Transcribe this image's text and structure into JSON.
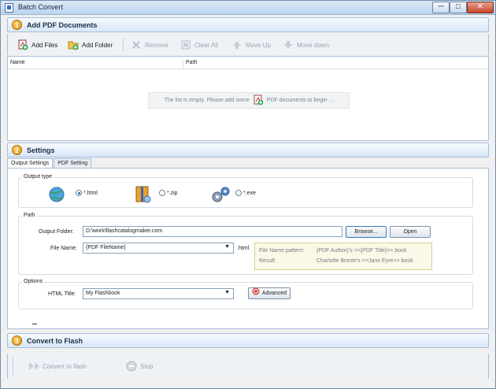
{
  "window": {
    "title": "Batch Convert",
    "controls": [
      "─",
      "□",
      "✕"
    ]
  },
  "sections": {
    "add": {
      "num": "1",
      "label": "Add PDF Documents"
    },
    "settings": {
      "num": "2",
      "label": "Settings"
    },
    "convert": {
      "num": "3",
      "label": "Convert to Flash"
    }
  },
  "toolbar": {
    "add_files": "Add Files",
    "add_folder": "Add Folder",
    "remove": "Remove",
    "clear_all": "Clear All",
    "move_up": "Move Up",
    "move_down": "Move down"
  },
  "list": {
    "columns": [
      "Name",
      "Path"
    ],
    "empty_text_1": "The list is empty. Please add some",
    "empty_text_2": "PDF documents to begin ..."
  },
  "tabs": [
    "Output Settings",
    "PDF Setting"
  ],
  "output_type": {
    "title": "Output type",
    "options": [
      "*.html",
      "*.zip",
      "*.exe"
    ],
    "selected": "*.html"
  },
  "path": {
    "title": "Path",
    "output_folder_label": "Output Folder:",
    "output_folder_value": "D:\\work\\flashcatalogmaker.com",
    "browse": "Browse...",
    "open": "Open",
    "file_name_label": "File Name:",
    "file_name_value": "{PDF FileName}",
    "file_ext": ".html",
    "pattern_label": "File Name pattern:",
    "pattern_value": "{PDF Author}'s <<{PDF Title}>> book",
    "result_label": "Result:",
    "result_value": "Charlotte Bronte's <<Jane Eyre>> book"
  },
  "options": {
    "title": "Options",
    "html_title_label": "HTML Title:",
    "html_title_value": "My Flashbook",
    "advanced": "Advanced"
  },
  "actions": {
    "convert": "Convert to flash",
    "stop": "Stop"
  }
}
